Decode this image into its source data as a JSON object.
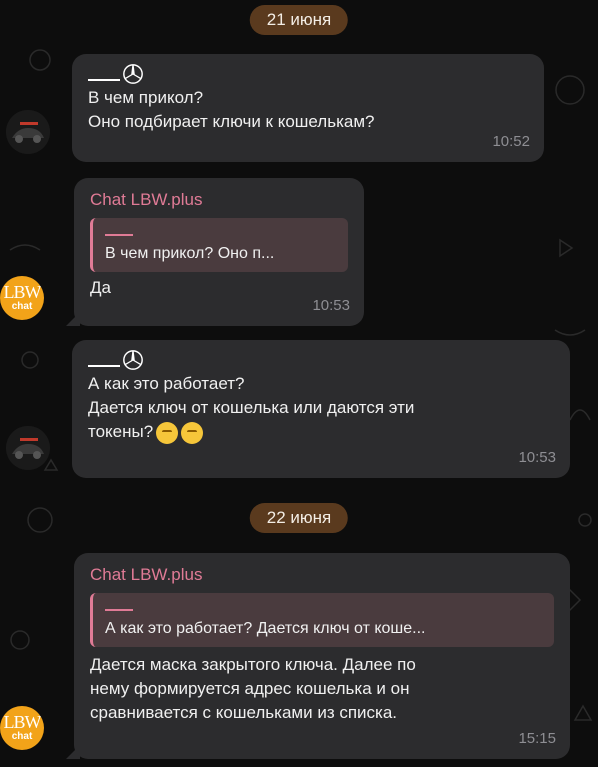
{
  "dates": [
    "21 июня",
    "22 июня"
  ],
  "messages": [
    {
      "sender_decoration": "mercedes-logo",
      "text": "В чем прикол?\nОно подбирает ключи к кошелькам?",
      "time": "10:52"
    },
    {
      "chat_name": "Chat LBW.plus",
      "quote": "В чем прикол?  Оно п...",
      "text": "Да",
      "time": "10:53"
    },
    {
      "sender_decoration": "mercedes-logo",
      "text": "А как это работает?\nДается ключ от кошелька или даются эти\nтокены?",
      "emojis": [
        "thinking-face-emoji",
        "monocle-face-emoji"
      ],
      "time": "10:53"
    },
    {
      "chat_name": "Chat LBW.plus",
      "quote": "А как это работает?  Дается ключ от коше...",
      "text": "Дается маска закрытого ключа. Далее по\nнему формируется адрес кошелька и он\nсравнивается с кошельками из списка.",
      "time": "15:15"
    }
  ],
  "avatar_lbw": {
    "top": "LBW",
    "bottom": "chat"
  },
  "colors": {
    "bubble": "#2c2c2e",
    "chat_name": "#e07b96",
    "date_pill": "#5a3a1e",
    "lbw_avatar": "#f2a319"
  }
}
